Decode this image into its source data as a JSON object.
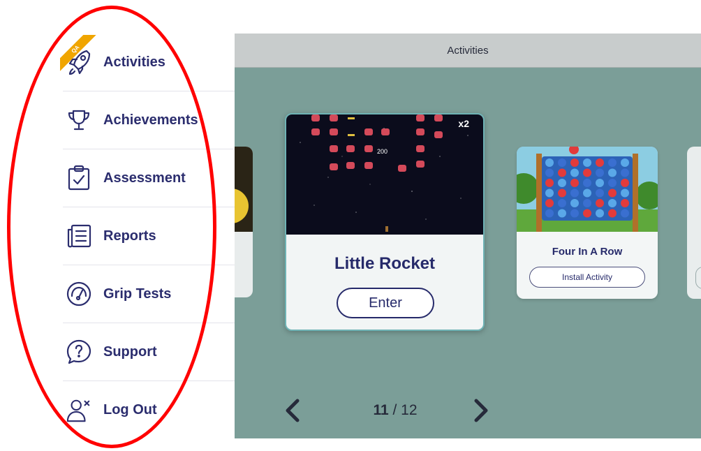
{
  "sidebar": {
    "badge": "QA",
    "items": [
      {
        "label": "Activities",
        "icon": "rocket-icon"
      },
      {
        "label": "Achievements",
        "icon": "trophy-icon"
      },
      {
        "label": "Assessment",
        "icon": "clipboard-check-icon"
      },
      {
        "label": "Reports",
        "icon": "report-list-icon"
      },
      {
        "label": "Grip Tests",
        "icon": "gauge-icon"
      },
      {
        "label": "Support",
        "icon": "question-circle-icon"
      },
      {
        "label": "Log Out",
        "icon": "user-remove-icon"
      }
    ]
  },
  "main": {
    "title": "Activities",
    "cards": {
      "center": {
        "title": "Little Rocket",
        "button": "Enter",
        "multiplier": "x2",
        "score_popup": "200"
      },
      "right": {
        "title": "Four In A Row",
        "button": "Install Activity"
      }
    },
    "pager": {
      "current": "11",
      "total": "/ 12"
    }
  },
  "colors": {
    "accent": "#262a6a",
    "background": "#7b9e98",
    "highlight_oval": "#ff0000",
    "badge": "#f0a500"
  }
}
